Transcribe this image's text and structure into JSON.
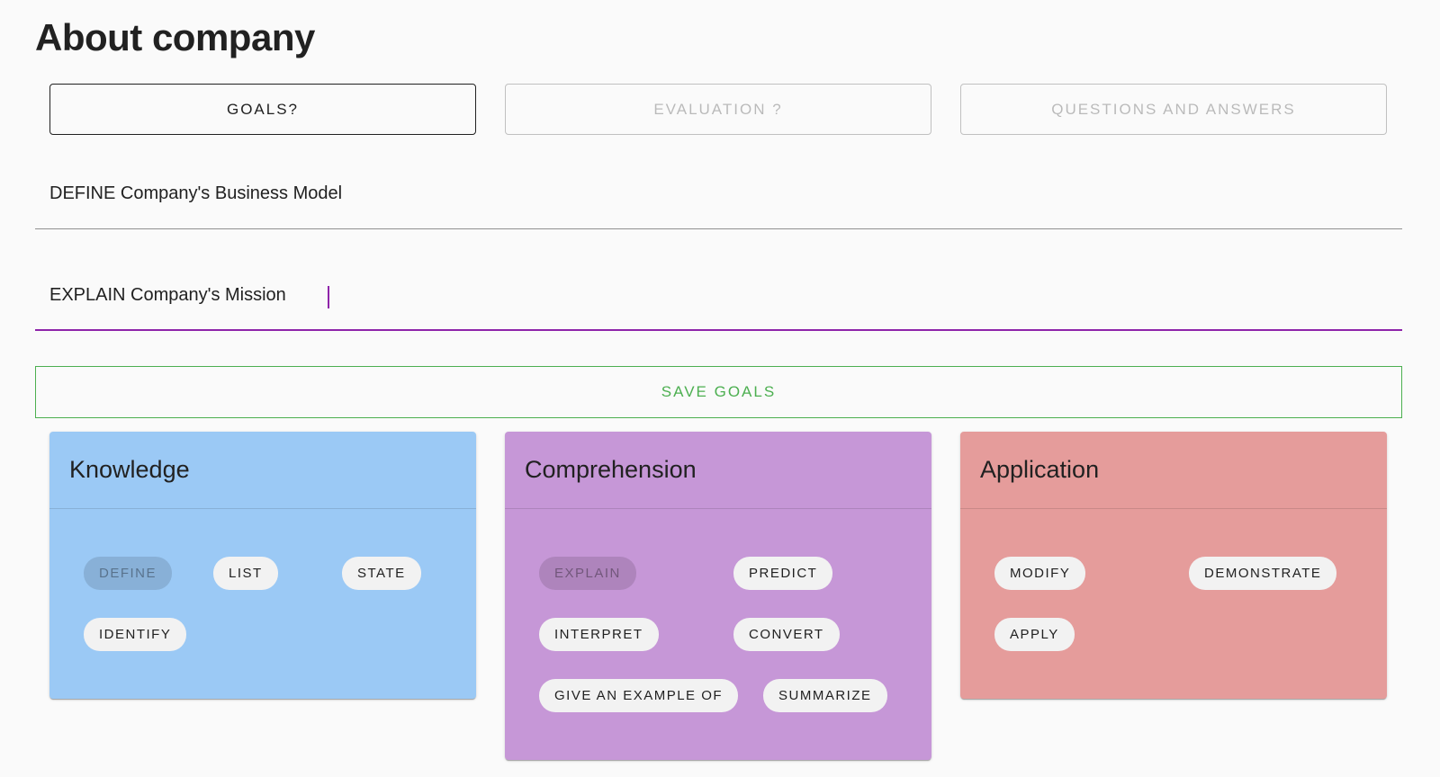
{
  "page": {
    "title": "About company"
  },
  "tabs": [
    {
      "label": "GOALS?",
      "active": true
    },
    {
      "label": "EVALUATION ?",
      "active": false
    },
    {
      "label": "QUESTIONS AND ANSWERS",
      "active": false
    }
  ],
  "goals": {
    "goal_1": "DEFINE Company's Business Model",
    "goal_2": "EXPLAIN Company's Mission"
  },
  "save_button": {
    "label": "SAVE GOALS"
  },
  "cards": {
    "knowledge": {
      "title": "Knowledge",
      "color": "#9bc9f5",
      "chips": [
        "DEFINE",
        "LIST",
        "STATE",
        "IDENTIFY"
      ],
      "selected": "DEFINE"
    },
    "comprehension": {
      "title": "Comprehension",
      "color": "#c697d7",
      "chips": [
        "EXPLAIN",
        "PREDICT",
        "INTERPRET",
        "CONVERT",
        "GIVE AN EXAMPLE OF",
        "SUMMARIZE"
      ],
      "selected": "EXPLAIN"
    },
    "application": {
      "title": "Application",
      "color": "#e59c9b",
      "chips": [
        "MODIFY",
        "DEMONSTRATE",
        "APPLY"
      ]
    }
  },
  "colors": {
    "focus_accent": "#8e24aa",
    "save_green": "#4caf50"
  }
}
